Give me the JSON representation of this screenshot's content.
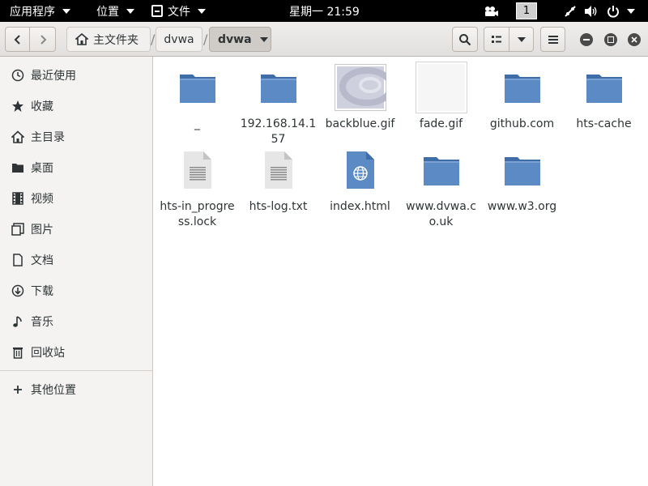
{
  "topbar": {
    "apps_label": "应用程序",
    "places_label": "位置",
    "files_label": "文件",
    "clock": "星期一 21:59",
    "workspace": "1"
  },
  "breadcrumbs": {
    "home": "主文件夹",
    "parent": "dvwa",
    "current": "dvwa"
  },
  "sidebar": {
    "items": [
      {
        "label": "最近使用",
        "icon": "clock-icon"
      },
      {
        "label": "收藏",
        "icon": "star-icon"
      },
      {
        "label": "主目录",
        "icon": "home-icon"
      },
      {
        "label": "桌面",
        "icon": "folder-icon"
      },
      {
        "label": "视频",
        "icon": "film-icon"
      },
      {
        "label": "图片",
        "icon": "image-icon"
      },
      {
        "label": "文档",
        "icon": "document-icon"
      },
      {
        "label": "下载",
        "icon": "download-icon"
      },
      {
        "label": "音乐",
        "icon": "music-icon"
      },
      {
        "label": "回收站",
        "icon": "trash-icon"
      }
    ],
    "other_locations": "其他位置"
  },
  "files": [
    {
      "name": "_",
      "type": "folder"
    },
    {
      "name": "192.168.14.157",
      "type": "folder"
    },
    {
      "name": "backblue.gif",
      "type": "image"
    },
    {
      "name": "fade.gif",
      "type": "image-blank"
    },
    {
      "name": "github.com",
      "type": "folder"
    },
    {
      "name": "hts-cache",
      "type": "folder"
    },
    {
      "name": "hts-in_progress.lock",
      "type": "text"
    },
    {
      "name": "hts-log.txt",
      "type": "text"
    },
    {
      "name": "index.html",
      "type": "html"
    },
    {
      "name": "www.dvwa.co.uk",
      "type": "folder"
    },
    {
      "name": "www.w3.org",
      "type": "folder"
    }
  ],
  "colors": {
    "folder": "#5b8ac4",
    "folder_tab": "#3f6da8",
    "topbar": "#000000"
  }
}
